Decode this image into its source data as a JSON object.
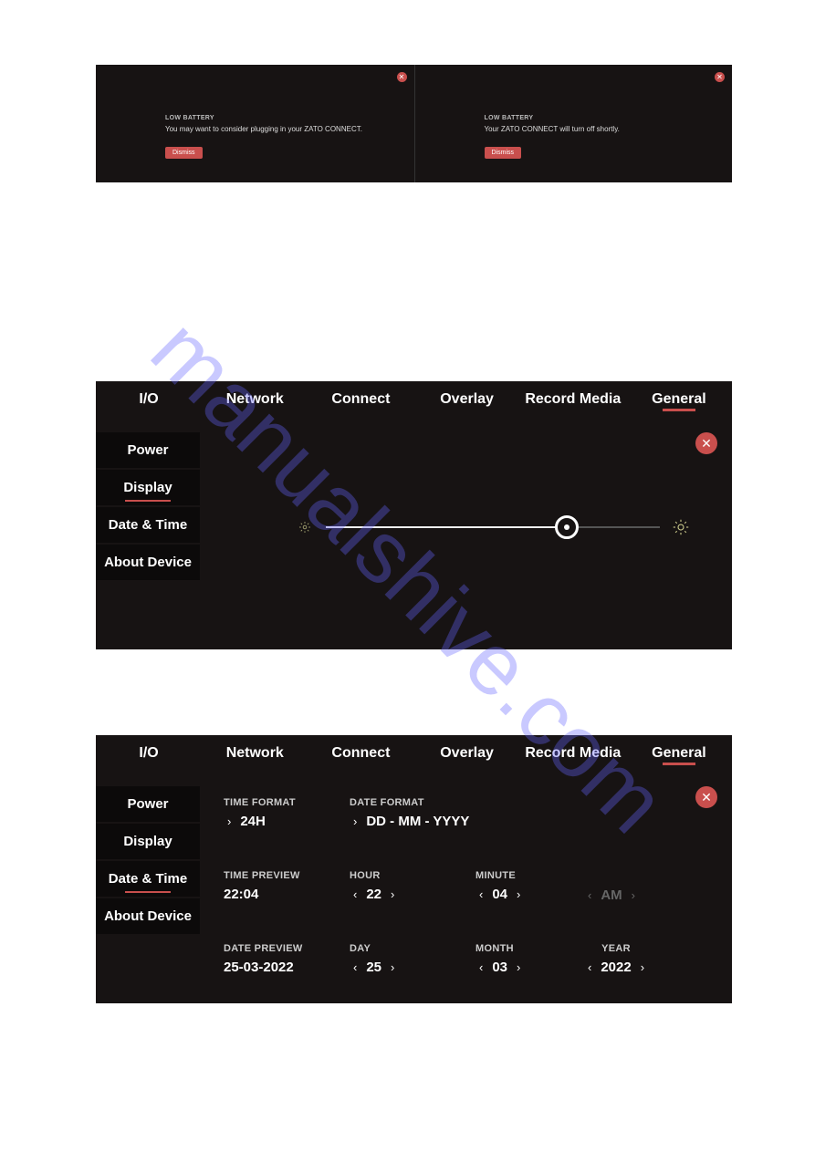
{
  "watermark": "manualshive.com",
  "notifications": [
    {
      "title": "LOW BATTERY",
      "message": "You may want to consider plugging in your ZATO CONNECT.",
      "dismiss": "Dismiss"
    },
    {
      "title": "LOW BATTERY",
      "message": "Your ZATO CONNECT will turn off shortly.",
      "dismiss": "Dismiss"
    }
  ],
  "tabs": [
    "I/O",
    "Network",
    "Connect",
    "Overlay",
    "Record Media",
    "General"
  ],
  "sidebar": [
    "Power",
    "Display",
    "Date & Time",
    "About Device"
  ],
  "panel_display": {
    "active_tab": "General",
    "active_side": "Display"
  },
  "panel_datetime": {
    "active_tab": "General",
    "active_side": "Date & Time",
    "labels": {
      "time_format": "TIME FORMAT",
      "date_format": "DATE FORMAT",
      "time_preview": "TIME PREVIEW",
      "hour": "HOUR",
      "minute": "MINUTE",
      "date_preview": "DATE PREVIEW",
      "day": "DAY",
      "month": "MONTH",
      "year": "YEAR",
      "ampm": "AM"
    },
    "values": {
      "time_format": "24H",
      "date_format": "DD - MM - YYYY",
      "time_preview": "22:04",
      "hour": "22",
      "minute": "04",
      "date_preview": "25-03-2022",
      "day": "25",
      "month": "03",
      "year": "2022"
    }
  }
}
